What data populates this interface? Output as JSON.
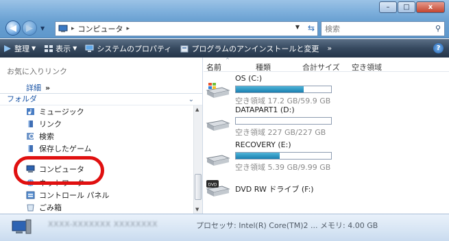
{
  "window": {
    "minimize_glyph": "–",
    "maximize_glyph": "□",
    "close_glyph": "x"
  },
  "address": {
    "crumb": "コンピュータ",
    "separator": "▸"
  },
  "search": {
    "placeholder": "検索"
  },
  "command_bar": {
    "items": [
      {
        "label": "整理",
        "icon": "organize-icon",
        "dropdown": true
      },
      {
        "label": "表示",
        "icon": "views-icon",
        "dropdown": true
      },
      {
        "label": "システムのプロパティ",
        "icon": "system-properties-icon",
        "dropdown": false
      },
      {
        "label": "プログラムのアンインストールと変更",
        "icon": "uninstall-icon",
        "dropdown": false
      }
    ],
    "more": "»",
    "help": "?"
  },
  "nav_pane": {
    "favorites_title": "お気に入りリンク",
    "detail_label": "詳細",
    "detail_chevron": "»",
    "folders_label": "フォルダ",
    "folders_chevron": "⌄",
    "tree": [
      {
        "label": "ミュージック",
        "icon": "music-folder-icon"
      },
      {
        "label": "リンク",
        "icon": "links-folder-icon"
      },
      {
        "label": "検索",
        "icon": "search-folder-icon"
      },
      {
        "label": "保存したゲーム",
        "icon": "saved-games-icon"
      },
      {
        "label": "コンピュータ",
        "icon": "computer-icon"
      },
      {
        "label": "ネットワーク",
        "icon": "network-icon"
      },
      {
        "label": "コントロール パネル",
        "icon": "control-panel-icon"
      },
      {
        "label": "ごみ箱",
        "icon": "recycle-bin-icon"
      }
    ]
  },
  "columns": [
    "名前",
    "種類",
    "合計サイズ",
    "空き領域"
  ],
  "drives": [
    {
      "name": "OS (C:)",
      "free_text": "空き領域 17.2 GB/59.9 GB",
      "used_fraction": 0.71,
      "icon": "windows-drive-icon"
    },
    {
      "name": "DATAPART1 (D:)",
      "free_text": "空き領域 227 GB/227 GB",
      "used_fraction": 0.0,
      "icon": "hard-drive-icon"
    },
    {
      "name": "RECOVERY (E:)",
      "free_text": "空き領域 5.39 GB/9.99 GB",
      "used_fraction": 0.46,
      "icon": "hard-drive-icon"
    },
    {
      "name": "DVD RW ドライブ (F:)",
      "free_text": "",
      "used_fraction": null,
      "icon": "dvd-drive-icon"
    }
  ],
  "details_pane": {
    "computer_name_blurred": "XXXX-XXXXXXX  XXXXXXXX",
    "processor": "プロセッサ: Intel(R) Core(TM)2 ...  メモリ: 4.00 GB"
  },
  "colors": {
    "bar_fill": "#1a7fb0",
    "highlight_circle": "#e01010",
    "link_blue": "#1c56a6"
  }
}
